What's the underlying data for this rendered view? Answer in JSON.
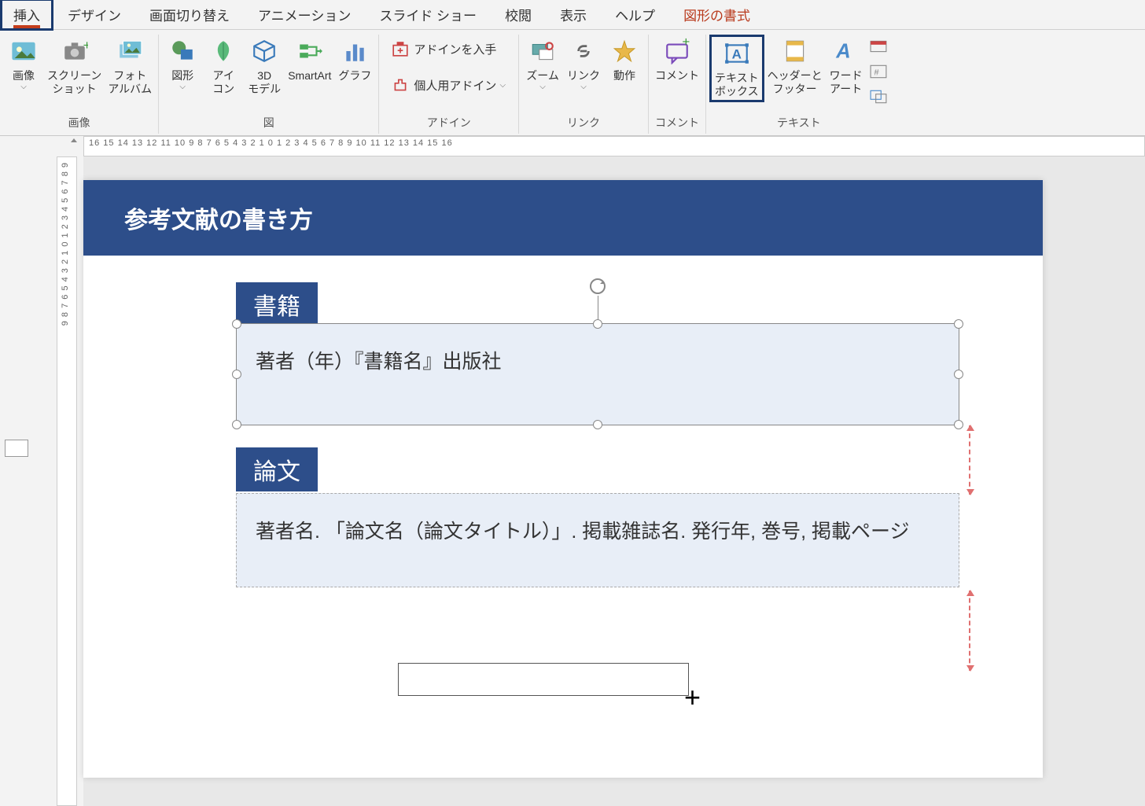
{
  "tabs": {
    "insert": "挿入",
    "design": "デザイン",
    "transitions": "画面切り替え",
    "animations": "アニメーション",
    "slideshow": "スライド ショー",
    "review": "校閲",
    "view": "表示",
    "help": "ヘルプ",
    "shape_format": "図形の書式"
  },
  "ribbon": {
    "images_group": "画像",
    "image": "画像",
    "screenshot": "スクリーン\nショット",
    "photo_album": "フォト\nアルバム",
    "illustrations_group": "図",
    "shapes": "図形",
    "icons": "アイ\nコン",
    "models3d": "3D\nモデル",
    "smartart": "SmartArt",
    "chart": "グラフ",
    "addins_group": "アドイン",
    "get_addins": "アドインを入手",
    "my_addins": "個人用アドイン",
    "links_group": "リンク",
    "zoom": "ズーム",
    "link": "リンク",
    "action": "動作",
    "comments_group": "コメント",
    "comment": "コメント",
    "text_group": "テキスト",
    "textbox": "テキスト\nボックス",
    "header_footer": "ヘッダーと\nフッター",
    "wordart": "ワード\nアート"
  },
  "ruler": {
    "horizontal": "16  15  14  13  12  11  10  9  8  7  6  5  4  3  2  1  0  1  2  3  4  5  6  7  8  9  10  11  12  13  14  15  16",
    "vertical": "9  8  7  6  5  4  3  2  1  0  1  2  3  4  5  6  7  8  9"
  },
  "slide": {
    "title": "参考文献の書き方",
    "section1_label": "書籍",
    "section1_text": "著者（年）『書籍名』出版社",
    "section2_label": "論文",
    "section2_text": "著者名. 「論文名（論文タイトル）」. 掲載雑誌名. 発行年, 巻号, 掲載ページ"
  }
}
